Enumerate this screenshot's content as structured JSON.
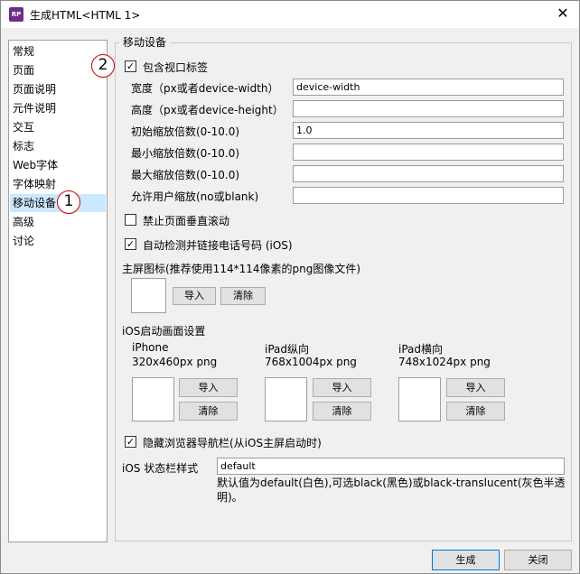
{
  "window": {
    "title": "生成HTML<HTML 1>",
    "app_icon_text": "RP",
    "close_glyph": "✕"
  },
  "nav": {
    "items": [
      "常规",
      "页面",
      "页面说明",
      "元件说明",
      "交互",
      "标志",
      "Web字体",
      "字体映射",
      "移动设备",
      "高级",
      "讨论"
    ],
    "selected_index": 8
  },
  "annotations": {
    "marker1": "1",
    "marker2": "2"
  },
  "mobile": {
    "group_title": "移动设备",
    "viewport_checkbox": {
      "label": "包含视口标签",
      "checked": true
    },
    "fields": [
      {
        "label": "宽度（px或者device-width）",
        "value": "device-width"
      },
      {
        "label": "高度（px或者device-height）",
        "value": ""
      },
      {
        "label": "初始缩放倍数(0-10.0)",
        "value": "1.0"
      },
      {
        "label": "最小缩放倍数(0-10.0)",
        "value": ""
      },
      {
        "label": "最大缩放倍数(0-10.0)",
        "value": ""
      },
      {
        "label": "允许用户缩放(no或blank)",
        "value": ""
      }
    ],
    "disable_scroll": {
      "label": "禁止页面垂直滚动",
      "checked": false
    },
    "detect_phone": {
      "label": "自动检测并链接电话号码 (iOS)",
      "checked": true
    },
    "home_icon": {
      "label": "主屏图标(推荐使用114*114像素的png图像文件)",
      "import": "导入",
      "clear": "清除"
    },
    "ios_splash": {
      "label": "iOS启动画面设置",
      "items": [
        {
          "name": "iPhone",
          "size": "320x460px png",
          "import": "导入",
          "clear": "清除"
        },
        {
          "name": "iPad纵向",
          "size": "768x1004px png",
          "import": "导入",
          "clear": "清除"
        },
        {
          "name": "iPad横向",
          "size": "748x1024px png",
          "import": "导入",
          "clear": "清除"
        }
      ]
    },
    "hide_nav": {
      "label": "隐藏浏览器导航栏(从iOS主屏启动时)",
      "checked": true
    },
    "status_bar": {
      "label": "iOS 状态栏样式",
      "value": "default",
      "hint_line1": "默认值为default(白色),可选black(黑色)或black-translucent(灰色半透",
      "hint_line2": "明)。"
    }
  },
  "footer": {
    "generate": "生成",
    "close": "关闭"
  }
}
